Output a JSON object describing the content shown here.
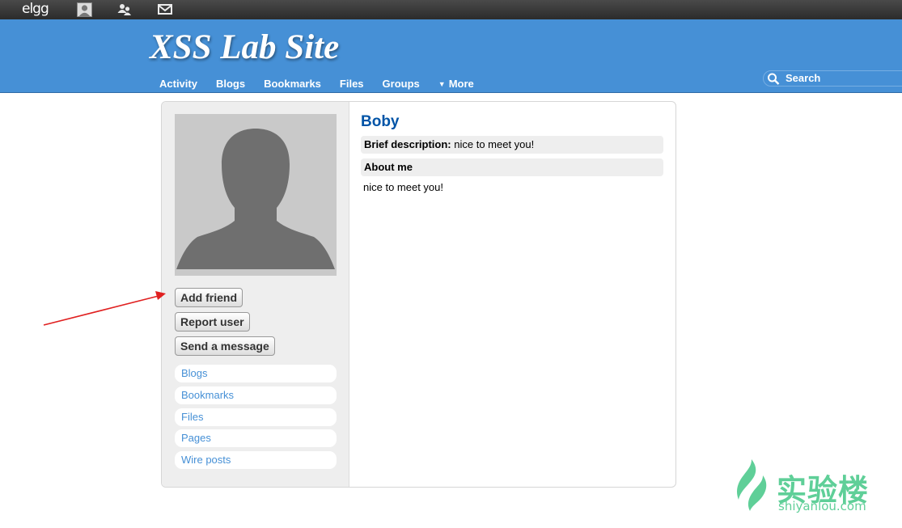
{
  "topbar": {
    "logo": "elgg",
    "icons": [
      "avatar-icon",
      "friends-icon",
      "messages-icon"
    ]
  },
  "header": {
    "site_title": "XSS Lab Site",
    "nav": [
      "Activity",
      "Blogs",
      "Bookmarks",
      "Files",
      "Groups",
      "More"
    ],
    "search_placeholder": "Search"
  },
  "owner_block": {
    "actions": [
      "Add friend",
      "Report user",
      "Send a message"
    ],
    "menu": [
      "Blogs",
      "Bookmarks",
      "Files",
      "Pages",
      "Wire posts"
    ]
  },
  "profile": {
    "name": "Boby",
    "brief_label": "Brief description:",
    "brief_value": "nice to meet you!",
    "about_label": "About me",
    "about_value": "nice to meet you!"
  },
  "watermark": {
    "cn": "实验楼",
    "en": "shiyanlou.com"
  },
  "colors": {
    "header_bg": "#4690d6",
    "topbar_bg": "#333333",
    "link": "#4690d6",
    "name": "#0054a7",
    "arrow": "#e02020",
    "watermark": "#5fcf98"
  }
}
